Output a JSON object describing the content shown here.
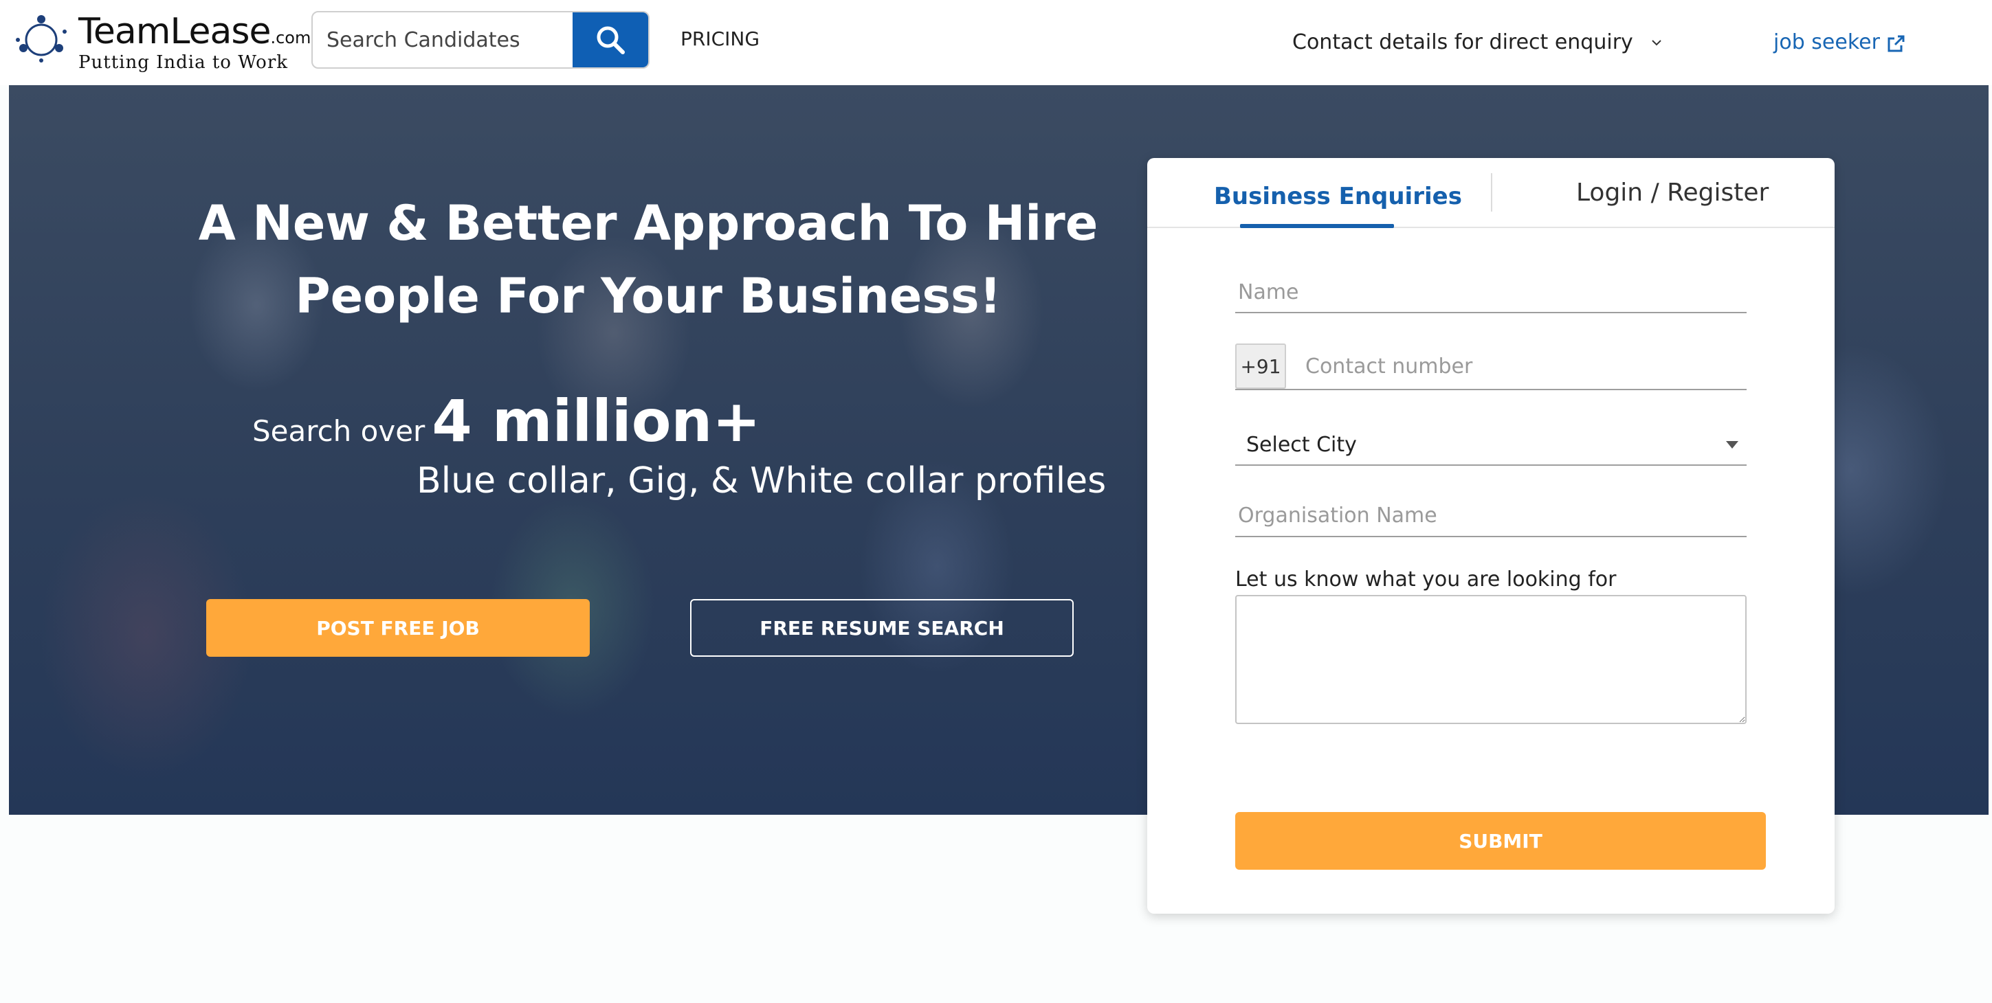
{
  "header": {
    "logo": {
      "name": "TeamLease",
      "suffix": ".com",
      "tagline": "Putting India to Work",
      "icon": "teamlease-logo-icon"
    },
    "search": {
      "placeholder": "Search Candidates",
      "icon": "search-icon"
    },
    "nav": {
      "pricing": "PRICING",
      "contact": "Contact details for direct enquiry",
      "job_seeker": "job seeker"
    },
    "icons": {
      "contact_dropdown": "chevron-down-icon",
      "job_seeker": "external-link-icon"
    }
  },
  "hero": {
    "title": "A New & Better Approach To Hire People For Your Business!",
    "stat_prefix": "Search over",
    "stat_value": "4 million+",
    "subtitle": "Blue collar, Gig, & White collar profiles",
    "post_job": "POST FREE JOB",
    "resume_search": "FREE RESUME SEARCH"
  },
  "form": {
    "tabs": [
      "Business Enquiries",
      "Login / Register"
    ],
    "active_tab": "Business Enquiries",
    "name_placeholder": "Name",
    "country_code": "+91",
    "contact_placeholder": "Contact number",
    "city": "Select City",
    "org_placeholder": "Organisation Name",
    "looking_label": "Let us know what you are looking for",
    "looking_value": "",
    "submit": "SUBMIT"
  },
  "colors": {
    "brand_blue": "#1560ad",
    "search_blue": "#0f5fb4",
    "accent_orange": "#ffa83a",
    "hero_overlay": "#2e3f5a"
  }
}
